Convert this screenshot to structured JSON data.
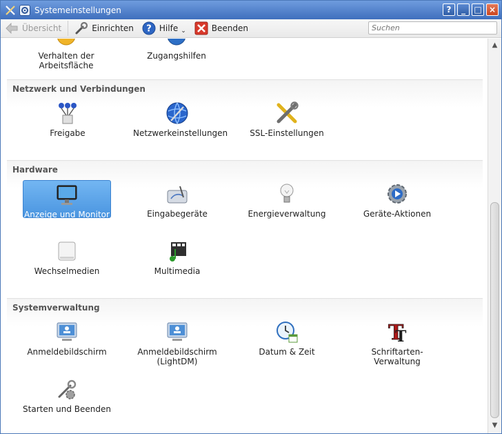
{
  "window": {
    "title": "Systemeinstellungen",
    "buttons": [
      "?",
      "_",
      "□",
      "×"
    ]
  },
  "toolbar": {
    "overview_label": "Übersicht",
    "configure_label": "Einrichten",
    "help_label": "Hilfe",
    "quit_label": "Beenden",
    "search_placeholder": "Suchen"
  },
  "top_partial": {
    "items": [
      {
        "label": "Verhalten der Arbeitsfläche",
        "icon": "workspace-icon"
      },
      {
        "label": "Zugangshilfen",
        "icon": "accessibility-icon"
      }
    ]
  },
  "sections": [
    {
      "title": "Netzwerk und Verbindungen",
      "items": [
        {
          "label": "Freigabe",
          "icon": "network-share-icon"
        },
        {
          "label": "Netzwerkeinstellungen",
          "icon": "globe-icon"
        },
        {
          "label": "SSL-Einstellungen",
          "icon": "tools-icon"
        }
      ]
    },
    {
      "title": "Hardware",
      "items": [
        {
          "label": "Anzeige und Monitor",
          "icon": "monitor-icon",
          "selected": true
        },
        {
          "label": "Eingabegeräte",
          "icon": "input-devices-icon"
        },
        {
          "label": "Energieverwaltung",
          "icon": "lightbulb-icon"
        },
        {
          "label": "Geräte-Aktionen",
          "icon": "gear-play-icon"
        },
        {
          "label": "Wechselmedien",
          "icon": "removable-drive-icon"
        },
        {
          "label": "Multimedia",
          "icon": "multimedia-icon"
        }
      ]
    },
    {
      "title": "Systemverwaltung",
      "items": [
        {
          "label": "Anmeldebildschirm",
          "icon": "login-screen-icon"
        },
        {
          "label": "Anmeldebildschirm (LightDM)",
          "icon": "login-screen-icon"
        },
        {
          "label": "Datum & Zeit",
          "icon": "clock-calendar-icon"
        },
        {
          "label": "Schriftarten-Verwaltung",
          "icon": "font-icon"
        },
        {
          "label": "Starten und Beenden",
          "icon": "startup-icon"
        }
      ]
    }
  ],
  "colors": {
    "titlebar": "#3f6fbd",
    "selection": "#4a95e0"
  }
}
